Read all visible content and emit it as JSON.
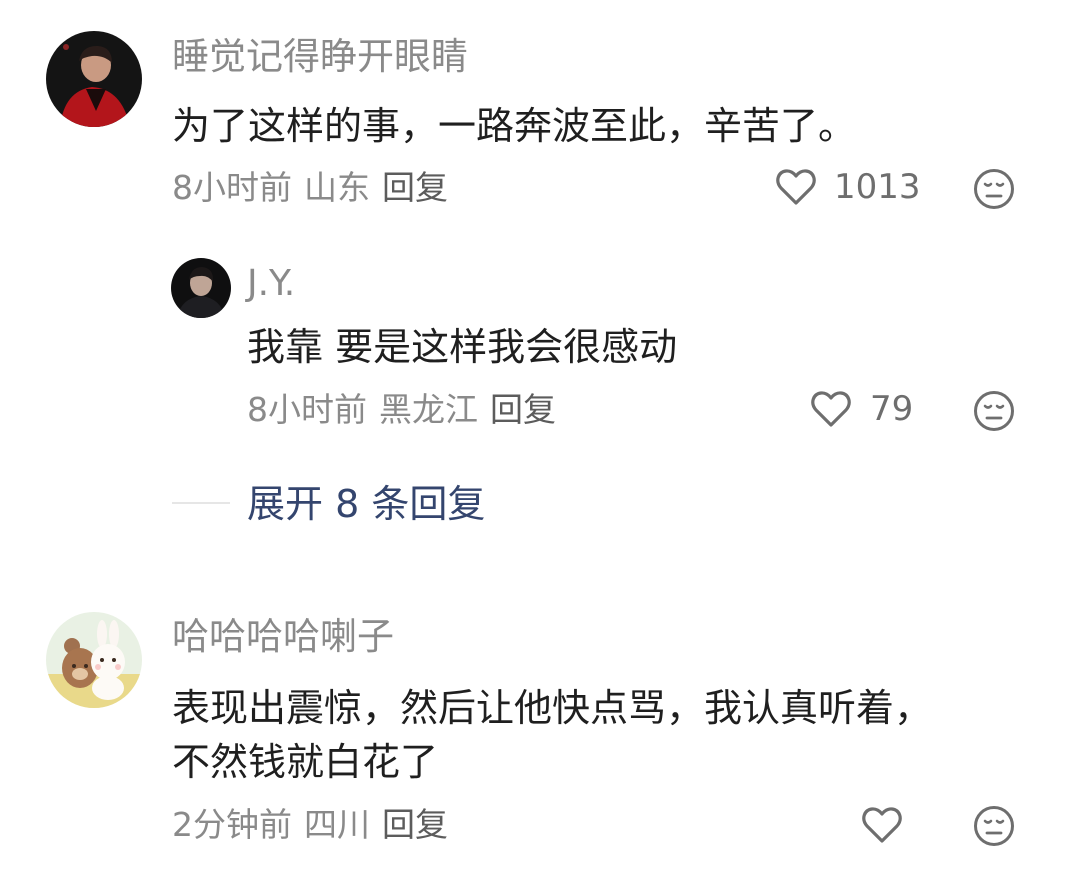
{
  "comments": [
    {
      "username": "睡觉记得睁开眼睛",
      "text": "为了这样的事，一路奔波至此，辛苦了。",
      "time": "8小时前",
      "location": "山东",
      "reply_label": "回复",
      "likes": "1013",
      "replies": [
        {
          "username": "J.Y.",
          "text": "我靠 要是这样我会很感动",
          "time": "8小时前",
          "location": "黑龙江",
          "reply_label": "回复",
          "likes": "79"
        }
      ],
      "expand_label": "展开 8 条回复"
    },
    {
      "username": "哈哈哈哈喇子",
      "text_lines": [
        "表现出震惊，然后让他快点骂，我认真听着，",
        "不然钱就白花了"
      ],
      "time": "2分钟前",
      "location": "四川",
      "reply_label": "回复",
      "likes": ""
    }
  ],
  "icons": {
    "like": "heart-outline-icon",
    "dislike": "neutral-face-icon"
  },
  "colors": {
    "username": "#8a8a8a",
    "meta": "#8a8a8a",
    "expand_link": "#34456e",
    "divider": "#e6e6e6"
  }
}
